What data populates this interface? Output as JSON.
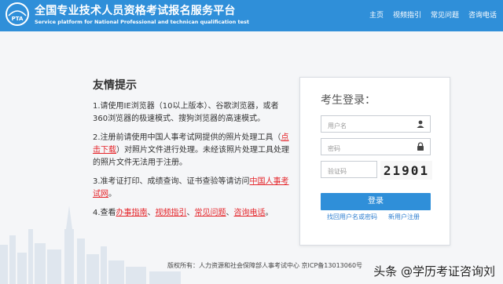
{
  "header": {
    "logo_text": "PTA",
    "title_cn": "全国专业技术人员资格考试报名服务平台",
    "title_en": "Service platform for National Professional and technican qualification test",
    "nav": [
      "主页",
      "视频指引",
      "常见问题",
      "咨询电话"
    ]
  },
  "notice": {
    "title": "友情提示",
    "item1": "1.请使用IE浏览器（10以上版本）、谷歌浏览器，或者360浏览器的极速模式、搜狗浏览器的高速模式。",
    "item2_a": "2.注册前请使用中国人事考试网提供的照片处理工具（",
    "item2_link": "点击下载",
    "item2_b": "）对照片文件进行处理。未经该照片处理工具处理的照片文件无法用于注册。",
    "item3_a": "3.准考证打印、成绩查询、证书查验等请访问",
    "item3_link": "中国人事考试网",
    "item3_b": "。",
    "item4_a": "4.查看",
    "item4_links": [
      "办事指南",
      "视频指引",
      "常见问题",
      "咨询电话"
    ],
    "item4_sep": "、",
    "item4_end": "。"
  },
  "login": {
    "title": "考生登录：",
    "username_placeholder": "用户名",
    "password_placeholder": "密码",
    "captcha_placeholder": "验证码",
    "captcha_code": "21901",
    "login_button": "登录",
    "forgot_link": "找回用户名或密码",
    "register_link": "新用户注册"
  },
  "footer": {
    "text": "版权所有：人力资源和社会保障部人事考试中心 京ICP备13013060号"
  },
  "watermark": {
    "text": "头条 @学历考证咨询刘"
  },
  "colors": {
    "header_bg": "#2f8fd9",
    "link_red": "#e5262b",
    "link_blue": "#2f7fd0",
    "button_bg": "#2f8fd9"
  }
}
